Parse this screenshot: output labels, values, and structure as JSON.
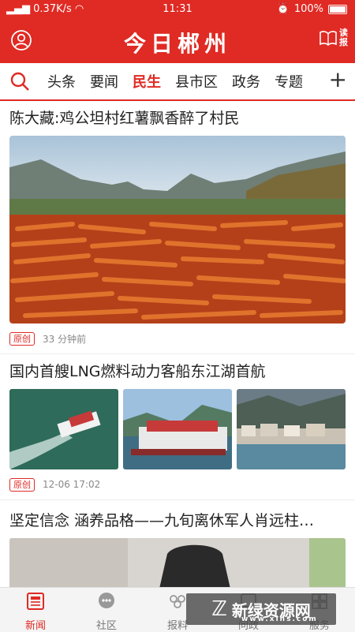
{
  "status": {
    "signal": "...ll",
    "speed": "0.37K/s",
    "time": "11:31",
    "battery": "100%"
  },
  "header": {
    "title": "今日郴州",
    "reader_label": "读报"
  },
  "tabs": {
    "items": [
      "头条",
      "要闻",
      "民生",
      "县市区",
      "政务",
      "专题"
    ],
    "active": "民生"
  },
  "news": [
    {
      "title": "陈大藏:鸡公坦村红薯飘香醉了村民",
      "badge": "原创",
      "meta": "33  分钟前"
    },
    {
      "title": "国内首艘LNG燃料动力客船东江湖首航",
      "badge": "原创",
      "meta": "12-06  17:02"
    },
    {
      "title": "坚定信念  涵养品格——九旬离休军人肖远柱…"
    }
  ],
  "bottom_nav": [
    {
      "label": "新闻",
      "icon": "news-icon"
    },
    {
      "label": "社区",
      "icon": "community-icon"
    },
    {
      "label": "报料",
      "icon": "report-icon"
    },
    {
      "label": "问政",
      "icon": "inquiry-icon"
    },
    {
      "label": "服务",
      "icon": "service-icon"
    }
  ],
  "watermark": {
    "text": "新绿资源网",
    "url": "www.xlhs.com"
  },
  "colors": {
    "brand": "#e02a24"
  }
}
